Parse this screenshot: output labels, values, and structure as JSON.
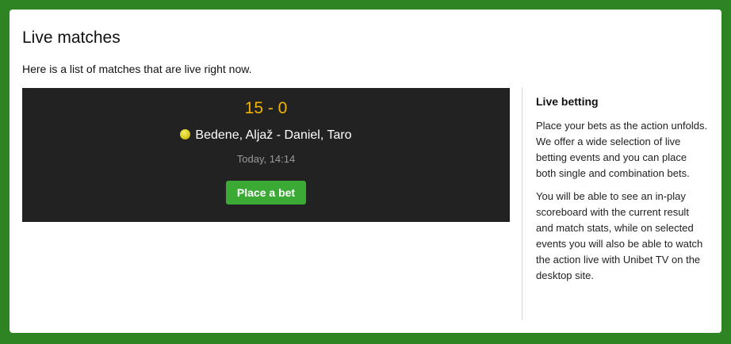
{
  "page": {
    "title": "Live matches",
    "subtitle": "Here is a list of matches that are live right now."
  },
  "match": {
    "score": "15 - 0",
    "sport_icon": "tennis-ball-icon",
    "teams": "Bedene, Aljaž - Daniel, Taro",
    "time": "Today, 14:14",
    "bet_label": "Place a bet"
  },
  "sidebar": {
    "title": "Live betting",
    "paragraphs": [
      "Place your bets as the action unfolds. We offer a wide selection of live betting events and you can place both single and combination bets.",
      "You will be able to see an in-play scoreboard with the current result and match stats, while on selected events you will also be able to watch the action live with Unibet TV on the desktop site."
    ]
  },
  "colors": {
    "background": "#2e8423",
    "score": "#f0b400",
    "bet_button": "#3aaa35",
    "match_card": "#222222"
  }
}
